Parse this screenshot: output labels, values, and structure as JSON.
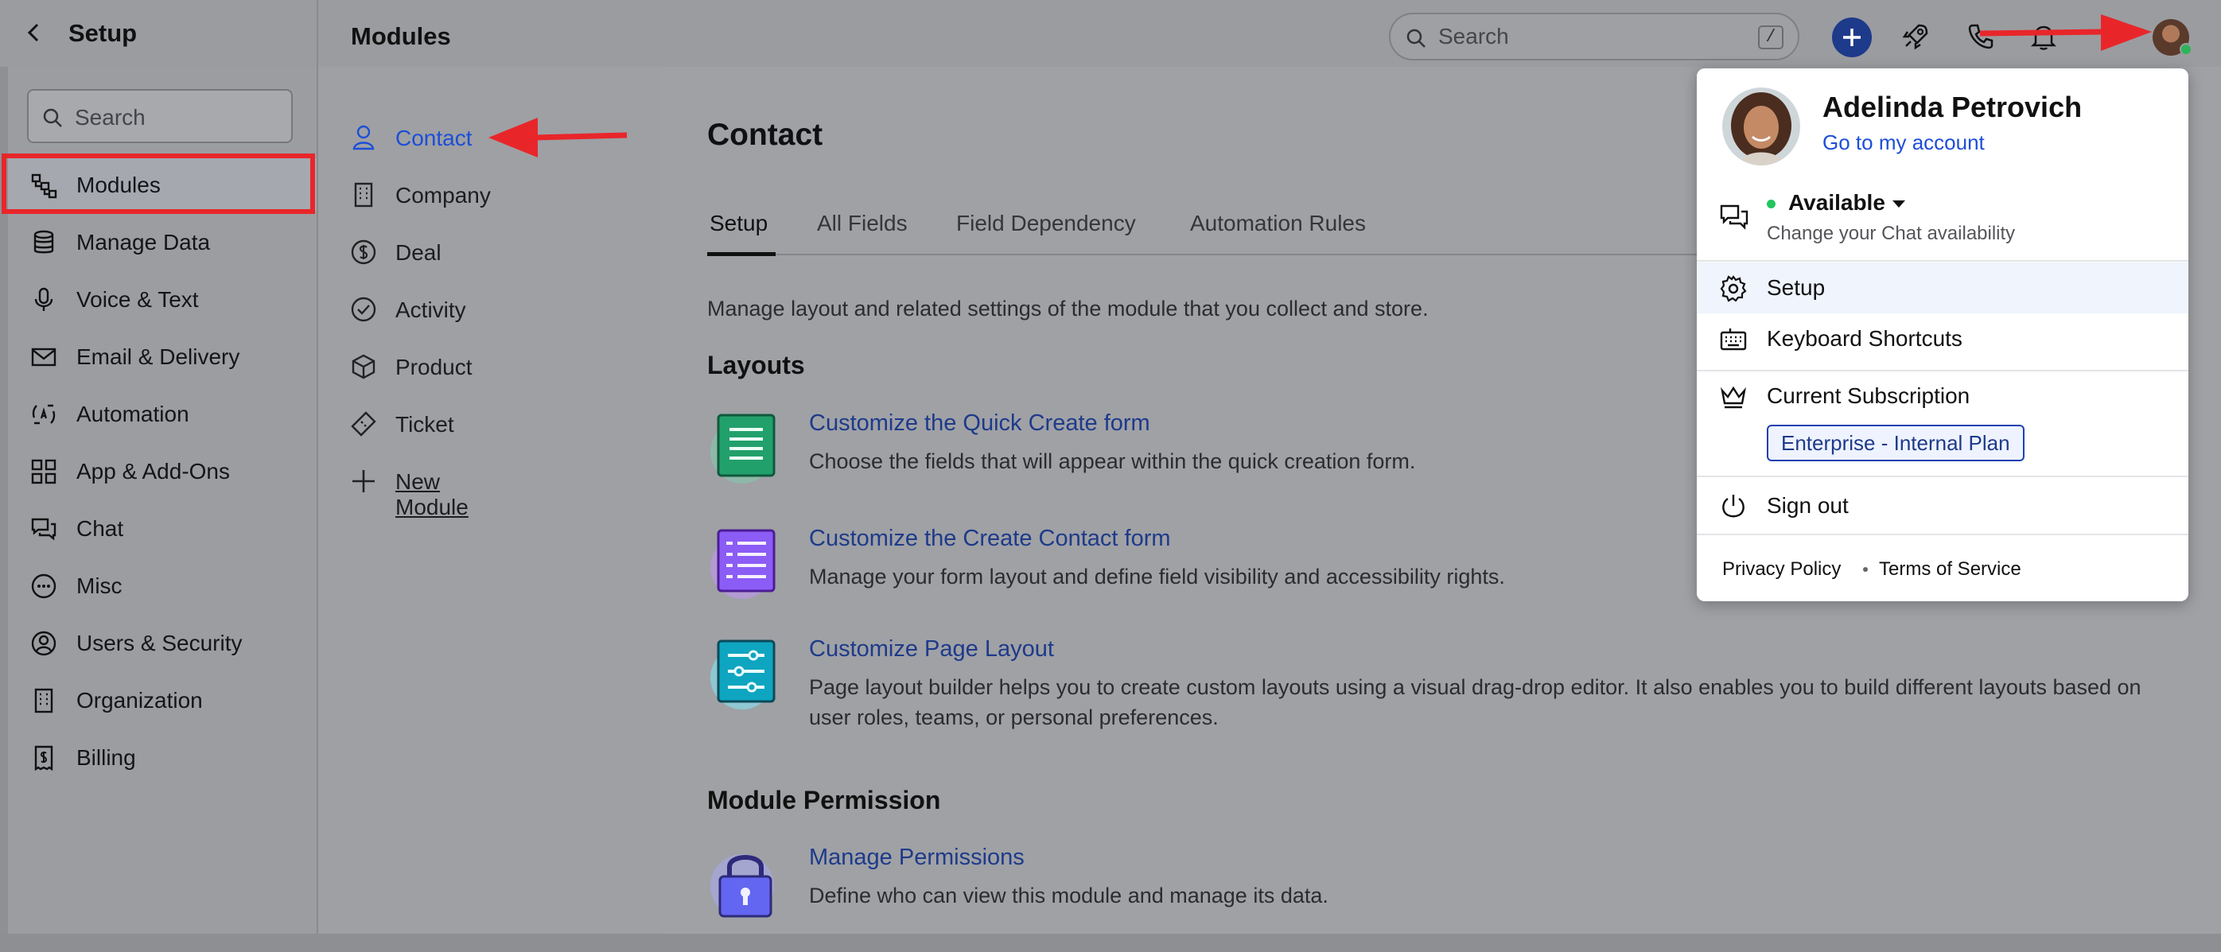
{
  "topbar": {
    "back_icon": "chevron-left-icon",
    "setup_title": "Setup",
    "modules_title": "Modules",
    "search_placeholder": "Search",
    "search_shortcut": "/",
    "icons": [
      "plus-icon",
      "rocket-icon",
      "phone-icon",
      "bell-icon",
      "avatar"
    ]
  },
  "sidebar": {
    "search_placeholder": "Search",
    "items": [
      {
        "label": "Modules",
        "icon": "modules-icon",
        "active": true
      },
      {
        "label": "Manage Data",
        "icon": "database-icon"
      },
      {
        "label": "Voice & Text",
        "icon": "microphone-icon"
      },
      {
        "label": "Email & Delivery",
        "icon": "mail-icon"
      },
      {
        "label": "Automation",
        "icon": "automation-icon"
      },
      {
        "label": "App & Add-Ons",
        "icon": "grid-icon"
      },
      {
        "label": "Chat",
        "icon": "chat-icon"
      },
      {
        "label": "Misc",
        "icon": "more-icon"
      },
      {
        "label": "Users & Security",
        "icon": "user-circle-icon"
      },
      {
        "label": "Organization",
        "icon": "building-icon"
      },
      {
        "label": "Billing",
        "icon": "receipt-icon"
      }
    ]
  },
  "modules": {
    "items": [
      {
        "label": "Contact",
        "icon": "person-icon",
        "active": true
      },
      {
        "label": "Company",
        "icon": "building-icon"
      },
      {
        "label": "Deal",
        "icon": "dollar-icon"
      },
      {
        "label": "Activity",
        "icon": "check-circle-icon"
      },
      {
        "label": "Product",
        "icon": "box-icon"
      },
      {
        "label": "Ticket",
        "icon": "ticket-icon"
      },
      {
        "label": "New Module",
        "icon": "plus-icon"
      }
    ]
  },
  "main": {
    "heading": "Contact",
    "tabs": [
      "Setup",
      "All Fields",
      "Field Dependency",
      "Automation Rules"
    ],
    "active_tab": "Setup",
    "description": "Manage layout and related settings of the module that you collect and store.",
    "layouts_heading": "Layouts",
    "layouts": [
      {
        "title": "Customize the Quick Create form",
        "desc": "Choose the fields that will appear within the quick creation form.",
        "icon": "list-form-icon",
        "color": "#10b981"
      },
      {
        "title": "Customize the Create Contact form",
        "desc": "Manage your form layout and define field visibility and accessibility rights.",
        "icon": "list-form-icon",
        "color": "#8b5cf6"
      },
      {
        "title": "Customize Page Layout",
        "desc": "Page layout builder helps you to create custom layouts using a visual drag-drop editor. It also enables you to build different layouts based on user roles, teams, or personal preferences.",
        "icon": "sliders-icon",
        "color": "#06b6d4"
      }
    ],
    "permission_heading": "Module Permission",
    "permission": {
      "title": "Manage Permissions",
      "desc": "Define who can view this module and manage its data.",
      "icon": "lock-icon",
      "color": "#4f46e5"
    }
  },
  "profile_menu": {
    "name": "Adelinda Petrovich",
    "account_link": "Go to my account",
    "status": "Available",
    "status_sub": "Change your Chat availability",
    "items": [
      {
        "label": "Setup",
        "icon": "gear-icon",
        "highlighted": true
      },
      {
        "label": "Keyboard Shortcuts",
        "icon": "keyboard-icon"
      },
      {
        "label": "Current Subscription",
        "icon": "crown-icon"
      },
      {
        "label": "Sign out",
        "icon": "power-icon"
      }
    ],
    "plan": "Enterprise - Internal Plan",
    "footer": [
      "Privacy Policy",
      "Terms of Service"
    ]
  },
  "colors": {
    "accent": "#1d4ed8",
    "annotation_red": "#e8262a",
    "link": "#1e3a8a"
  }
}
